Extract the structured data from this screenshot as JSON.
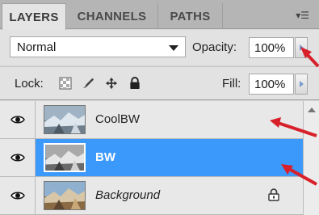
{
  "tabs": [
    {
      "label": "LAYERS",
      "active": true
    },
    {
      "label": "CHANNELS",
      "active": false
    },
    {
      "label": "PATHS",
      "active": false
    }
  ],
  "blend_mode": {
    "value": "Normal"
  },
  "opacity": {
    "label": "Opacity:",
    "value": "100%"
  },
  "lock": {
    "label": "Lock:"
  },
  "fill": {
    "label": "Fill:",
    "value": "100%"
  },
  "layers": [
    {
      "name": "CoolBW",
      "selected": false,
      "italic": false,
      "locked": false
    },
    {
      "name": "BW",
      "selected": true,
      "italic": false,
      "locked": false
    },
    {
      "name": "Background",
      "selected": false,
      "italic": true,
      "locked": true
    }
  ],
  "colors": {
    "selection": "#3b99fc",
    "annotation_arrow": "#d8202a"
  }
}
